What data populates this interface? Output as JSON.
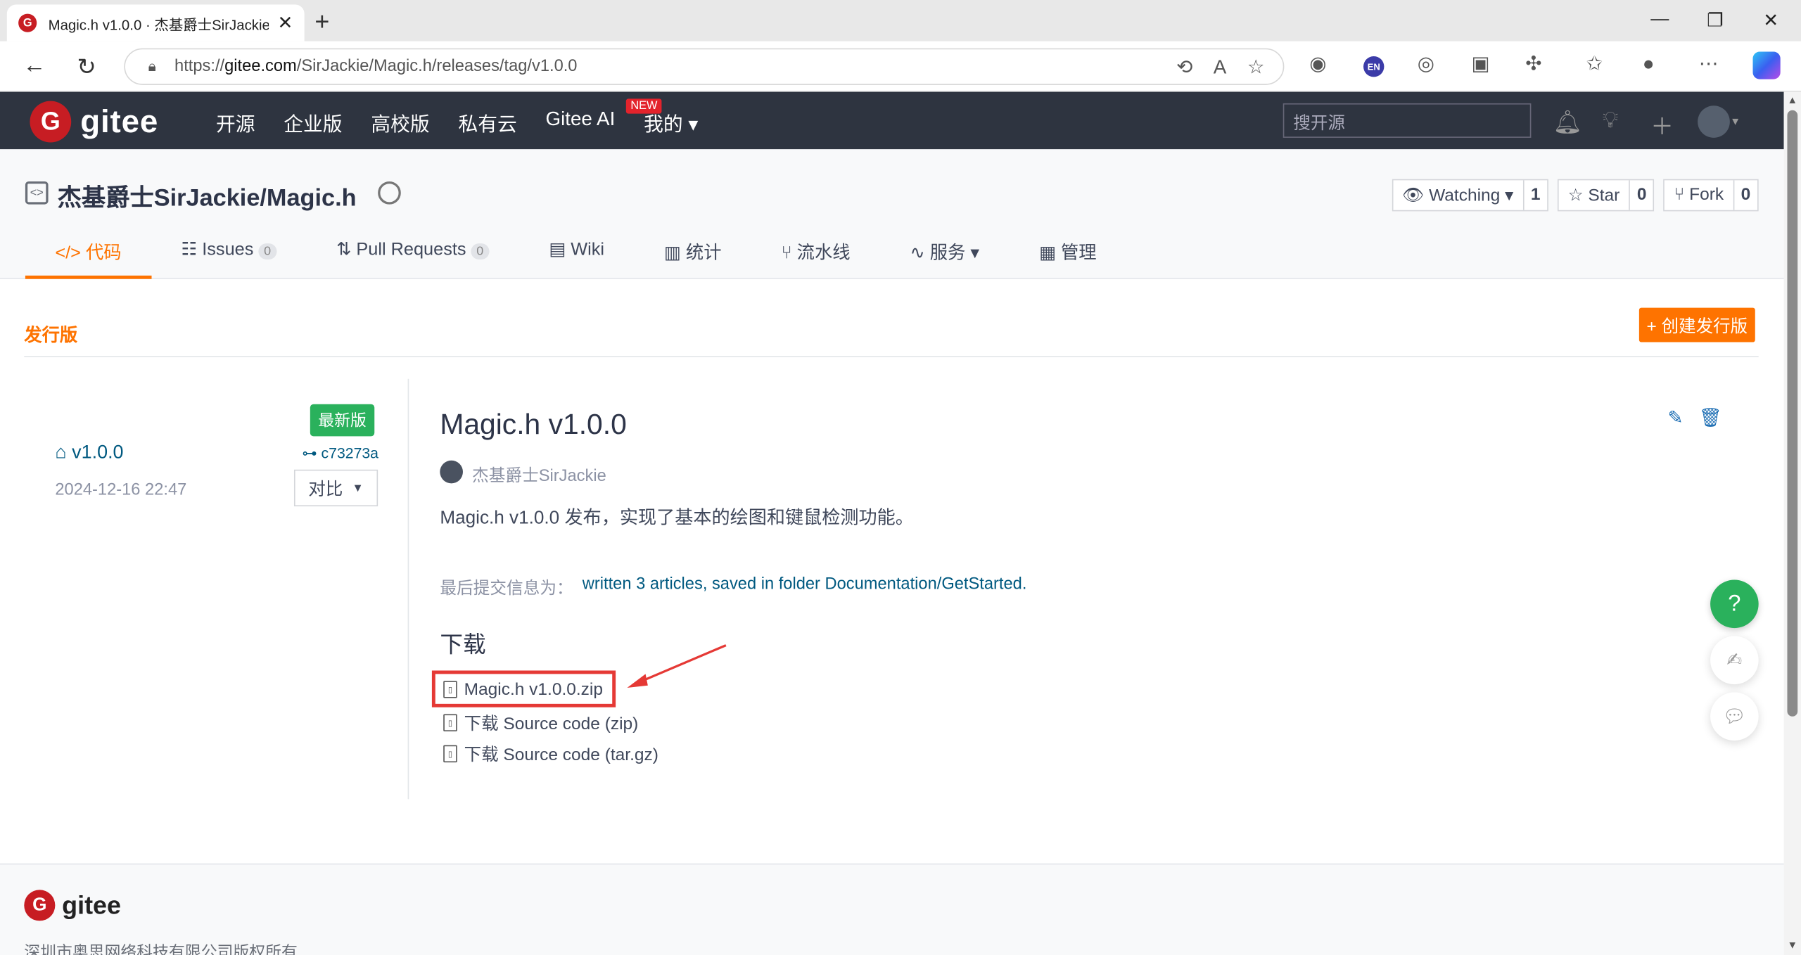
{
  "browser": {
    "tab_title": "Magic.h v1.0.0 · 杰基爵士SirJackie",
    "tab_close": "✕",
    "new_tab": "+",
    "url_prefix": "https://",
    "url_domain": "gitee.com",
    "url_path": "/SirJackie/Magic.h/releases/tag/v1.0.0",
    "ext_en": "EN"
  },
  "header": {
    "logo_letter": "G",
    "logo_text": "gitee",
    "nav": [
      "开源",
      "企业版",
      "高校版",
      "私有云",
      "Gitee AI",
      "我的 ▾"
    ],
    "new_badge": "NEW",
    "search_placeholder": "搜开源"
  },
  "repo": {
    "name": "杰基爵士SirJackie/Magic.h",
    "watching_label": "Watching ▾",
    "watching_count": "1",
    "star_label": "☆ Star",
    "star_count": "0",
    "fork_label": "Fork",
    "fork_count": "0",
    "tabs": [
      {
        "label": "</> 代码"
      },
      {
        "label": "Issues",
        "badge": "0"
      },
      {
        "label": "Pull Requests",
        "badge": "0"
      },
      {
        "label": "Wiki"
      },
      {
        "label": "统计"
      },
      {
        "label": "流水线"
      },
      {
        "label": "服务 ▾"
      },
      {
        "label": "管理"
      }
    ]
  },
  "release": {
    "section_title": "发行版",
    "create_button": "+ 创建发行版",
    "latest_badge": "最新版",
    "tag": "v1.0.0",
    "commit": "c73273a",
    "date": "2024-12-16 22:47",
    "compare_button": "对比",
    "title": "Magic.h v1.0.0",
    "author": "杰基爵士SirJackie",
    "description": "Magic.h v1.0.0 发布，实现了基本的绘图和键鼠检测功能。",
    "last_commit_label": "最后提交信息为：",
    "last_commit_msg": "written 3 articles, saved in folder Documentation/GetStarted.",
    "downloads_title": "下载",
    "downloads": [
      "Magic.h v1.0.0.zip",
      "下载 Source code (zip)",
      "下载 Source code (tar.gz)"
    ]
  },
  "floating": {
    "help": "?"
  },
  "footer": {
    "logo_letter": "G",
    "logo_text": "gitee",
    "copyright": "深圳市奥思网络科技有限公司版权所有"
  }
}
